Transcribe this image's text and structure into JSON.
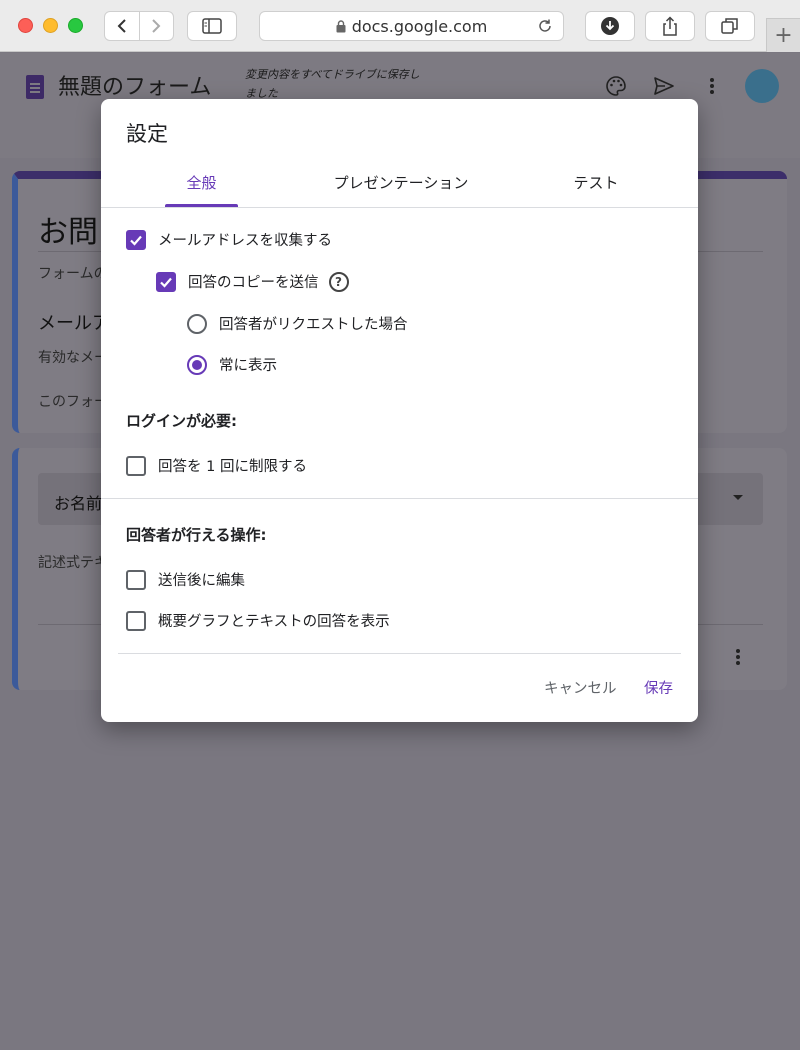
{
  "browser": {
    "url": "docs.google.com",
    "new_tab": "+"
  },
  "app": {
    "title": "無題のフォーム",
    "save_status": "変更内容をすべてドライブに保存しました",
    "card1": {
      "title": "お問",
      "description": "フォームの",
      "question": "メールア",
      "hint": "有効なメー",
      "note": "このフォー"
    },
    "card2": {
      "question": "お名前",
      "answer_hint": "記述式テキ"
    }
  },
  "dialog": {
    "title": "設定",
    "tabs": [
      {
        "label": "全般",
        "active": true
      },
      {
        "label": "プレゼンテーション",
        "active": false
      },
      {
        "label": "テスト",
        "active": false
      }
    ],
    "collect_email": {
      "label": "メールアドレスを収集する",
      "checked": true
    },
    "send_copy": {
      "label": "回答のコピーを送信",
      "checked": true
    },
    "copy_options": [
      {
        "label": "回答者がリクエストした場合",
        "selected": false
      },
      {
        "label": "常に表示",
        "selected": true
      }
    ],
    "login_section": "ログインが必要:",
    "limit_one": {
      "label": "回答を 1 回に制限する",
      "checked": false
    },
    "respondent_section": "回答者が行える操作:",
    "edit_after": {
      "label": "送信後に編集",
      "checked": false
    },
    "show_summary": {
      "label": "概要グラフとテキストの回答を表示",
      "checked": false
    },
    "cancel_label": "キャンセル",
    "save_label": "保存"
  },
  "colors": {
    "accent": "#673ab7",
    "overlay_bg": "#7a7780"
  }
}
